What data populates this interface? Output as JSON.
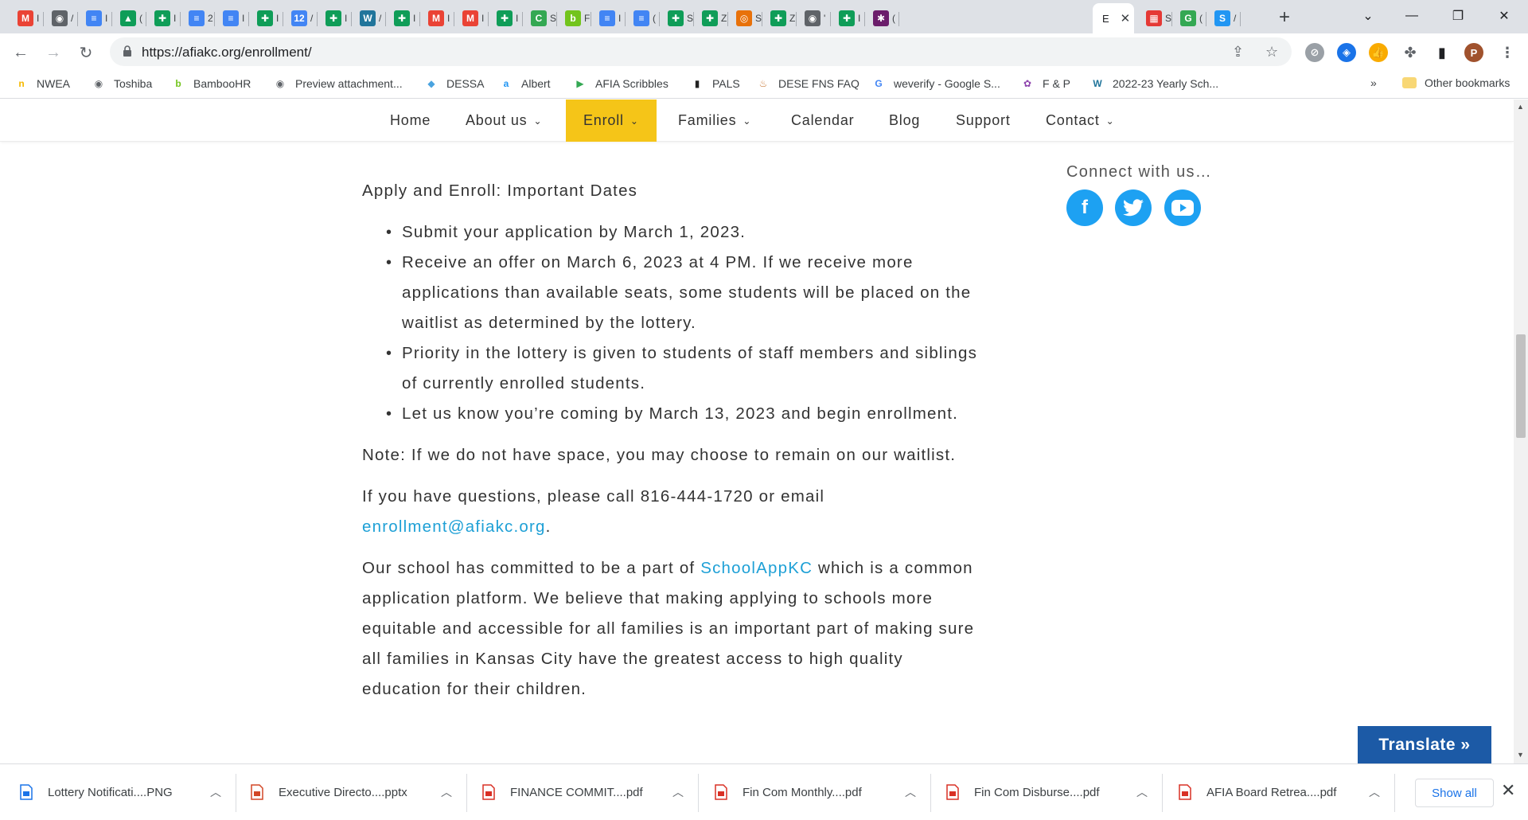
{
  "browser": {
    "active_tab_letter": "E",
    "url": "https://afiakc.org/enrollment/",
    "tabs": [
      {
        "icon": "gmail-icon",
        "color": "#ea4335",
        "glyph": "M",
        "mini": "I"
      },
      {
        "icon": "globe-icon",
        "color": "#5f6368",
        "glyph": "◉",
        "mini": "/"
      },
      {
        "icon": "docs-icon",
        "color": "#4285f4",
        "glyph": "≡",
        "mini": "I"
      },
      {
        "icon": "drive-icon",
        "color": "#0f9d58",
        "glyph": "▲",
        "mini": "("
      },
      {
        "icon": "sheets-icon",
        "color": "#0f9d58",
        "glyph": "✚",
        "mini": "I"
      },
      {
        "icon": "docs-icon",
        "color": "#4285f4",
        "glyph": "≡",
        "mini": "2"
      },
      {
        "icon": "docs-icon",
        "color": "#4285f4",
        "glyph": "≡",
        "mini": "I"
      },
      {
        "icon": "sheets-icon",
        "color": "#0f9d58",
        "glyph": "✚",
        "mini": "I"
      },
      {
        "icon": "calendar-icon",
        "color": "#4285f4",
        "glyph": "12",
        "mini": "/"
      },
      {
        "icon": "sheets-icon",
        "color": "#0f9d58",
        "glyph": "✚",
        "mini": "I"
      },
      {
        "icon": "wordpress-icon",
        "color": "#21759b",
        "glyph": "W",
        "mini": "/"
      },
      {
        "icon": "sheets-icon",
        "color": "#0f9d58",
        "glyph": "✚",
        "mini": "I"
      },
      {
        "icon": "gmail-icon",
        "color": "#ea4335",
        "glyph": "M",
        "mini": "I"
      },
      {
        "icon": "gmail-icon",
        "color": "#ea4335",
        "glyph": "M",
        "mini": "I"
      },
      {
        "icon": "sheets-icon",
        "color": "#0f9d58",
        "glyph": "✚",
        "mini": "I"
      },
      {
        "icon": "classroom-icon",
        "color": "#34a853",
        "glyph": "C",
        "mini": "S"
      },
      {
        "icon": "bamboo-icon",
        "color": "#73c41d",
        "glyph": "b",
        "mini": "F"
      },
      {
        "icon": "docs-icon",
        "color": "#4285f4",
        "glyph": "≡",
        "mini": "I"
      },
      {
        "icon": "docs-icon",
        "color": "#4285f4",
        "glyph": "≡",
        "mini": "("
      },
      {
        "icon": "sheets-icon",
        "color": "#0f9d58",
        "glyph": "✚",
        "mini": "S"
      },
      {
        "icon": "sheets-icon",
        "color": "#0f9d58",
        "glyph": "✚",
        "mini": "Z"
      },
      {
        "icon": "target-icon",
        "color": "#e8710a",
        "glyph": "◎",
        "mini": "S"
      },
      {
        "icon": "sheets-icon",
        "color": "#0f9d58",
        "glyph": "✚",
        "mini": "Z"
      },
      {
        "icon": "globe-icon",
        "color": "#5f6368",
        "glyph": "◉",
        "mini": "'"
      },
      {
        "icon": "sheets-icon",
        "color": "#0f9d58",
        "glyph": "✚",
        "mini": "I"
      },
      {
        "icon": "slack-icon",
        "color": "#6b1d6b",
        "glyph": "✱",
        "mini": "("
      }
    ],
    "tabs_after": [
      {
        "icon": "grid-icon",
        "color": "#e53935",
        "glyph": "▦",
        "mini": "S"
      },
      {
        "icon": "google-g-icon",
        "color": "#34a853",
        "glyph": "G",
        "mini": "("
      },
      {
        "icon": "schoolapp-icon",
        "color": "#2196f3",
        "glyph": "S",
        "mini": "/"
      }
    ]
  },
  "bookmarks": [
    {
      "label": "NWEA",
      "icon": "nwea-icon",
      "color": "#f5b800",
      "glyph": "n"
    },
    {
      "label": "Toshiba",
      "icon": "globe-icon",
      "color": "#5f6368",
      "glyph": "◉"
    },
    {
      "label": "BambooHR",
      "icon": "bamboo-icon",
      "color": "#73c41d",
      "glyph": "b"
    },
    {
      "label": "Preview attachment...",
      "icon": "globe-icon",
      "color": "#5f6368",
      "glyph": "◉"
    },
    {
      "label": "DESSA",
      "icon": "dessa-icon",
      "color": "#4aa3df",
      "glyph": "◆"
    },
    {
      "label": "Albert",
      "icon": "albert-icon",
      "color": "#2196f3",
      "glyph": "a"
    },
    {
      "label": "AFIA Scribbles",
      "icon": "play-icon",
      "color": "#34a853",
      "glyph": "▶"
    },
    {
      "label": "PALS",
      "icon": "pencil-icon",
      "color": "#222222",
      "glyph": "▮"
    },
    {
      "label": "DESE FNS FAQ",
      "icon": "flame-icon",
      "color": "#c97b3c",
      "glyph": "♨"
    },
    {
      "label": "weverify - Google S...",
      "icon": "google-icon",
      "color": "#4285f4",
      "glyph": "G"
    },
    {
      "label": "F & P",
      "icon": "fp-icon",
      "color": "#8e44ad",
      "glyph": "✿"
    },
    {
      "label": "2022-23 Yearly Sch...",
      "icon": "wordpress-icon",
      "color": "#21759b",
      "glyph": "W"
    }
  ],
  "other_bookmarks": "Other bookmarks",
  "bookmarks_overflow": "»",
  "profile_initial": "P",
  "site_nav": [
    {
      "label": "Home",
      "caret": false
    },
    {
      "label": "About us",
      "caret": true
    },
    {
      "label": "Enroll",
      "caret": true,
      "active": true
    },
    {
      "label": "Families",
      "caret": true
    },
    {
      "label": "Calendar",
      "caret": false
    },
    {
      "label": "Blog",
      "caret": false
    },
    {
      "label": "Support",
      "caret": false
    },
    {
      "label": "Contact",
      "caret": true
    }
  ],
  "content": {
    "heading": "Apply and Enroll: Important Dates",
    "bullets": [
      "Submit your application by March 1, 2023.",
      "Receive an offer on March 6, 2023 at 4 PM. If we receive more applications than available seats, some students will be placed on the waitlist as determined by the lottery.",
      "Priority in the lottery is given to students of staff members and siblings of currently enrolled students.",
      "Let us know you’re coming by March 13, 2023 and begin enrollment."
    ],
    "note": "Note: If we do not have space, you may choose to remain on our waitlist.",
    "questions_prefix": "If you have questions, please call 816-444-1720 or email",
    "questions_email": "enrollment@afiakc.org",
    "questions_suffix": ".",
    "schoolapp_prefix": "Our school has committed to be a part of",
    "schoolapp_link": "SchoolAppKC",
    "schoolapp_suffix": "which is a common application platform. We believe that making applying to schools more equitable and accessible for all families is an important part of making sure all families in Kansas City have the greatest access to high quality education for their children."
  },
  "sidebar": {
    "connect": "Connect with us…",
    "social": [
      {
        "name": "facebook-icon",
        "glyph": "f"
      },
      {
        "name": "twitter-icon",
        "glyph": "🐦"
      },
      {
        "name": "youtube-icon",
        "glyph": "▶"
      }
    ]
  },
  "translate_label": "Translate »",
  "downloads": [
    {
      "name": "Lottery Notificati....PNG",
      "icon": "image-file-icon",
      "color": "#1a73e8"
    },
    {
      "name": "Executive Directo....pptx",
      "icon": "pptx-file-icon",
      "color": "#d24726"
    },
    {
      "name": "FINANCE COMMIT....pdf",
      "icon": "pdf-file-icon",
      "color": "#d93025"
    },
    {
      "name": "Fin Com Monthly....pdf",
      "icon": "pdf-file-icon",
      "color": "#d93025"
    },
    {
      "name": "Fin Com Disburse....pdf",
      "icon": "pdf-file-icon",
      "color": "#d93025"
    },
    {
      "name": "AFIA Board Retrea....pdf",
      "icon": "pdf-file-icon",
      "color": "#d93025"
    }
  ],
  "show_all": "Show all"
}
